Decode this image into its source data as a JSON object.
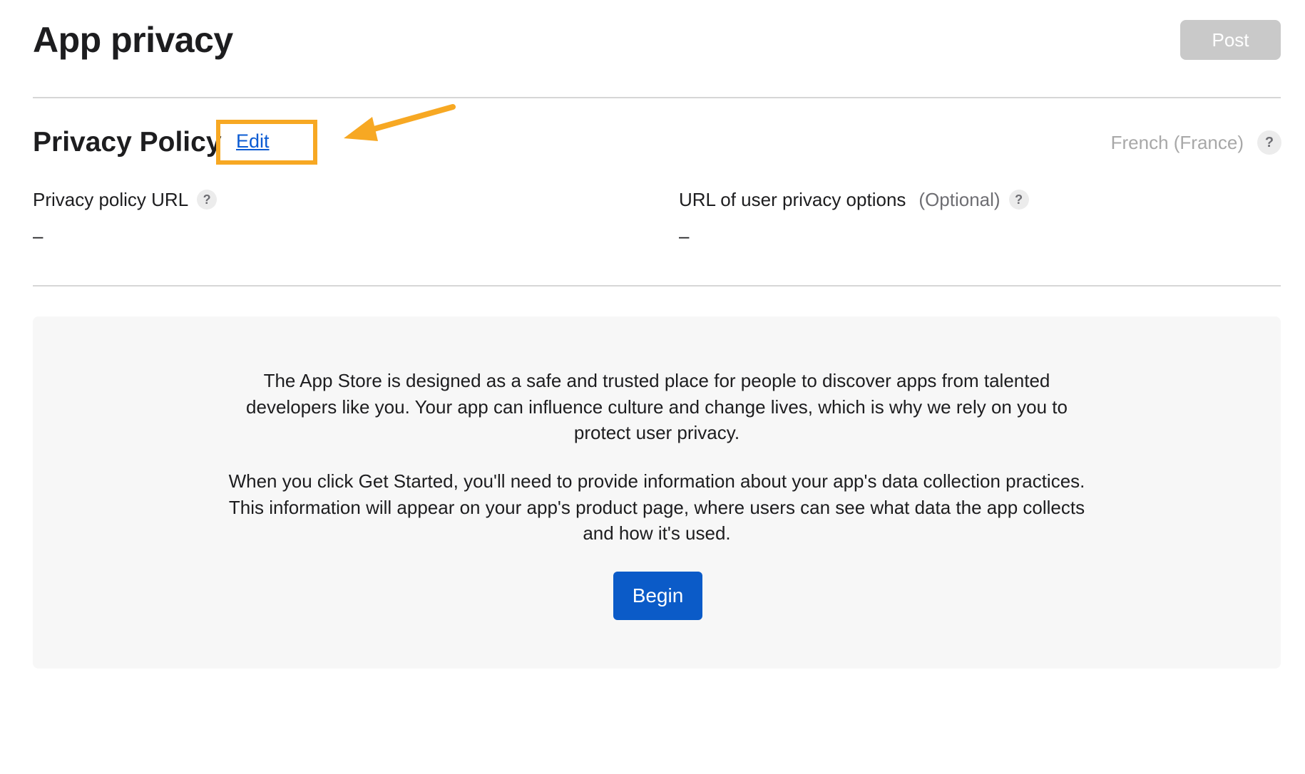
{
  "header": {
    "title": "App privacy",
    "post_label": "Post"
  },
  "privacy_policy": {
    "title": "Privacy Policy",
    "edit_label": "Edit",
    "language": "French (France)",
    "help_glyph": "?",
    "fields": [
      {
        "label": "Privacy policy URL",
        "optional": "",
        "value": "–"
      },
      {
        "label": "URL of user privacy options",
        "optional": "(Optional)",
        "value": "–"
      }
    ]
  },
  "info_panel": {
    "paragraph_1": "The App Store is designed as a safe and trusted place for people to discover apps from talented developers like you. Your app can influence culture and change lives, which is why we rely on you to protect user privacy.",
    "paragraph_2": "When you click Get Started, you'll need to provide information about your app's data collection practices. This information will appear on your app's product page, where users can see what data the app collects and how it's used.",
    "begin_label": "Begin"
  },
  "colors": {
    "annotation": "#f7a823",
    "link": "#0b5bd3",
    "primary_button": "#0b5bc8",
    "disabled_button": "#c9c9c9"
  },
  "icons": {
    "help": "question-mark-icon",
    "annotation_arrow": "arrow-icon"
  }
}
